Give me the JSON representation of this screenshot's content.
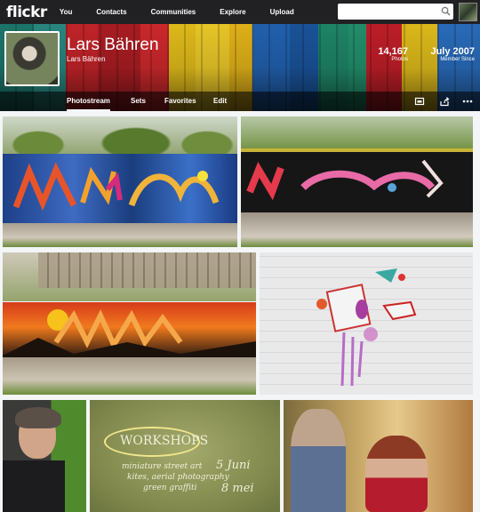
{
  "topnav": {
    "logo": "flickr",
    "links": [
      "You",
      "Contacts",
      "Communities",
      "Explore",
      "Upload"
    ],
    "search_placeholder": ""
  },
  "profile": {
    "name": "Lars Bähren",
    "subtitle": "Lars Bähren",
    "photos_count": "14,167",
    "photos_label": "Photos",
    "member_since": "July 2007",
    "member_since_label": "Member Since"
  },
  "subnav": {
    "tabs": [
      "Photostream",
      "Sets",
      "Favorites",
      "Edit"
    ],
    "active_tab": "Photostream"
  },
  "photos": {
    "chalkboard_lines": [
      "WORKSHOPS",
      "miniature street art",
      "kites, aerial photography",
      "green graffiti",
      "5 Juni",
      "8 mei"
    ]
  },
  "colors": {
    "nav_bg": "#212124",
    "page_bg": "#f3f5f6"
  }
}
